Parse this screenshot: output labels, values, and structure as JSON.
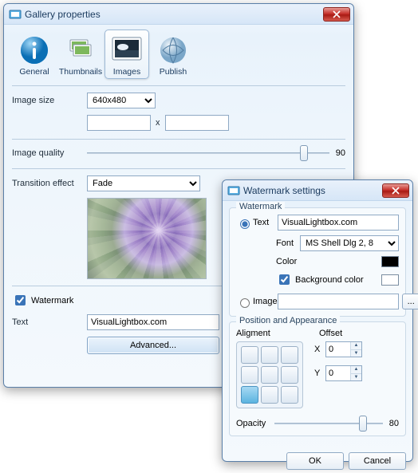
{
  "gallery": {
    "title": "Gallery properties",
    "tabs": {
      "general": "General",
      "thumbnails": "Thumbnails",
      "images": "Images",
      "publish": "Publish"
    },
    "imageSize": {
      "label": "Image size",
      "selected": "640x480",
      "w": "",
      "h": "",
      "x": "x"
    },
    "quality": {
      "label": "Image quality",
      "value": "90"
    },
    "transition": {
      "label": "Transition effect",
      "selected": "Fade"
    },
    "watermarkChk": "Watermark",
    "text": {
      "label": "Text",
      "value": "VisualLightbox.com"
    },
    "advanced": "Advanced..."
  },
  "wm": {
    "title": "Watermark settings",
    "groupWatermark": "Watermark",
    "optText": "Text",
    "textValue": "VisualLightbox.com",
    "font": {
      "label": "Font",
      "value": "MS Shell Dlg 2, 8"
    },
    "color": {
      "label": "Color",
      "value": "#000000"
    },
    "bgcolor": {
      "label": "Background color",
      "value": "#ffffff"
    },
    "optImage": "Image",
    "imageValue": "",
    "browse": "...",
    "groupPos": "Position and Appearance",
    "alignment": "Aligment",
    "offset": "Offset",
    "x": {
      "label": "X",
      "value": "0"
    },
    "y": {
      "label": "Y",
      "value": "0"
    },
    "opacity": {
      "label": "Opacity",
      "value": "80"
    },
    "ok": "OK",
    "cancel": "Cancel"
  }
}
